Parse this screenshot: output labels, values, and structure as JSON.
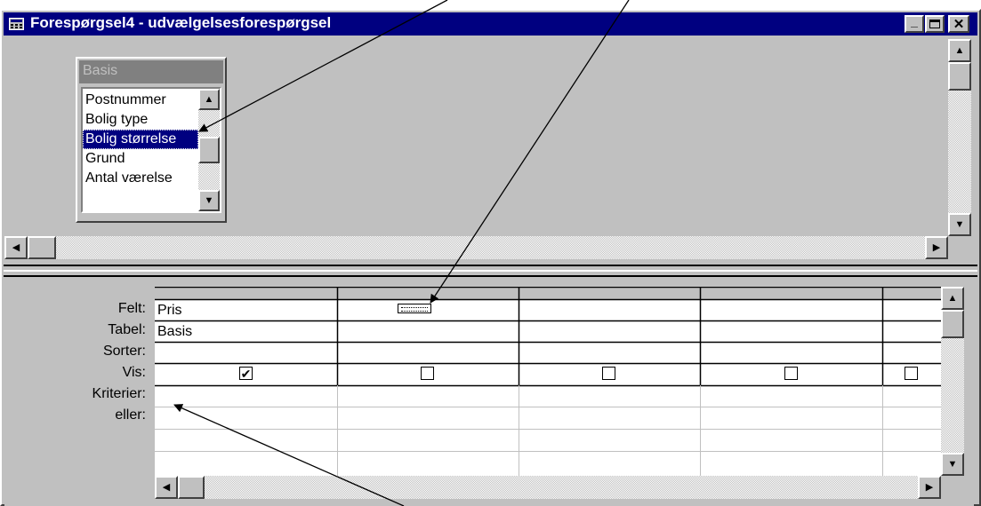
{
  "window": {
    "title": "Forespørgsel4 - udvælgelsesforespørgsel",
    "minimize": "_",
    "maximize": "□",
    "close": "✕"
  },
  "table_box": {
    "title": "Basis",
    "fields": [
      "Postnummer",
      "Bolig type",
      "Bolig størrelse",
      "Grund",
      "Antal værelse"
    ],
    "selected_index": 2
  },
  "grid": {
    "row_labels": [
      "Felt:",
      "Tabel:",
      "Sorter:",
      "Vis:",
      "Kriterier:",
      "eller:"
    ],
    "columns": [
      {
        "felt": "Pris",
        "tabel": "Basis",
        "sorter": "",
        "vis": true
      },
      {
        "felt": "",
        "tabel": "",
        "sorter": "",
        "vis": false
      },
      {
        "felt": "",
        "tabel": "",
        "sorter": "",
        "vis": false
      },
      {
        "felt": "",
        "tabel": "",
        "sorter": "",
        "vis": false
      },
      {
        "felt": "",
        "tabel": "",
        "sorter": "",
        "vis": false
      }
    ],
    "check_glyph": "✔"
  },
  "scroll": {
    "up": "▲",
    "down": "▼",
    "left": "◀",
    "right": "▶"
  }
}
